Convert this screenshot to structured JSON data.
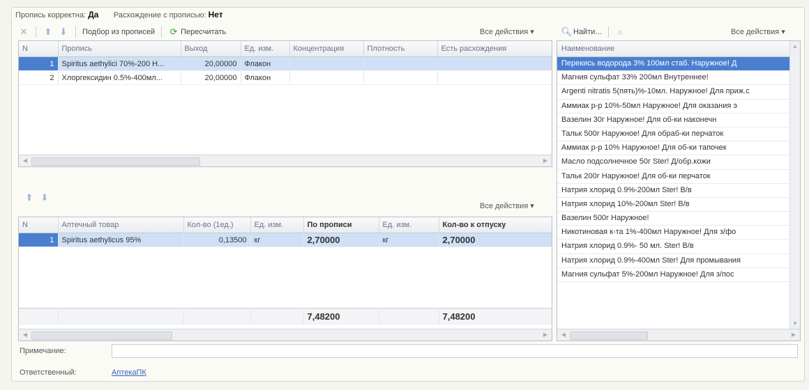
{
  "status": {
    "recipe_correct_label": "Пропись корректна:",
    "recipe_correct_value": "Да",
    "discrepancy_label": "Расхождение с прописью:",
    "discrepancy_value": "Нет"
  },
  "toolbar1": {
    "pick_label": "Подбор из прописей",
    "recalc_label": "Пересчитать",
    "all_actions": "Все действия ▾"
  },
  "right_toolbar": {
    "find_label": "Найти...",
    "all_actions": "Все действия ▾"
  },
  "grid1": {
    "columns": [
      "N",
      "Пропись",
      "Выход",
      "Ед. изм.",
      "Концентрация",
      "Плотность",
      "Есть расхождения"
    ],
    "rows": [
      {
        "n": "1",
        "recipe": "Spiritus aethylici 70%-200 Н...",
        "output": "20,00000",
        "unit": "Флакон",
        "conc": "",
        "density": "",
        "diff": ""
      },
      {
        "n": "2",
        "recipe": "Хлоргексидин 0.5%-400мл...",
        "output": "20,00000",
        "unit": "Флакон",
        "conc": "",
        "density": "",
        "diff": ""
      }
    ]
  },
  "toolbar2": {
    "all_actions": "Все действия ▾"
  },
  "grid2": {
    "columns": [
      "N",
      "Аптечный товар",
      "Кол-во (1ед.)",
      "Ед. изм.",
      "По прописи",
      "Ед. изм.",
      "Кол-во к отпуску"
    ],
    "rows": [
      {
        "n": "1",
        "item": "Spiritus aethylicus 95%",
        "qty": "0,13500",
        "unit": "кг",
        "by_recipe": "2,70000",
        "unit2": "кг",
        "to_dispense": "2,70000"
      }
    ],
    "totals": {
      "by_recipe": "7,48200",
      "to_dispense": "7,48200"
    }
  },
  "list": {
    "header": "Наименование",
    "items": [
      "Перекись водорода 3% 100мл стаб.  Наружное!  Д",
      "Магния сульфат 33% 200мл Внутреннее!",
      "Argenti nitratis 5(пять)%-10мл. Наружное!  Для приж.с",
      "Аммиак р-р 10%-50мл Наружное!   Для оказания э",
      "Вазелин 30г  Наружное!          Для об-ки наконечн",
      "Тальк 500г Наружное!        Для обраб-ки перчаток",
      "Аммиак р-р 10%  Наружное!   Для об-ки тапочек",
      "Масло подсолнечное 50г Ster! Д/обр.кожи",
      "Тальк 200г  Наружное!         Для об-ки перчаток",
      "Натрия хлорид 0.9%-200мл Ster! В/в",
      "Натрия хлорид 10%-200мл  Ster!   В/в",
      "Вазелин 500г Наружное!",
      "Никотиновая к-та 1%-400мл Наружное!    Для з/фо",
      "Натрия хлорид 0.9%- 50 мл. Ster!  В/в",
      "Натрия хлорид 0.9%-400мл Ster!   Для промывания",
      "Магния сульфат 5%-200мл  Наружное!   Для з/пос"
    ]
  },
  "footer": {
    "note_label": "Примечание:",
    "note_value": "",
    "responsible_label": "Ответственный:",
    "responsible_value": "АптекаПК"
  }
}
